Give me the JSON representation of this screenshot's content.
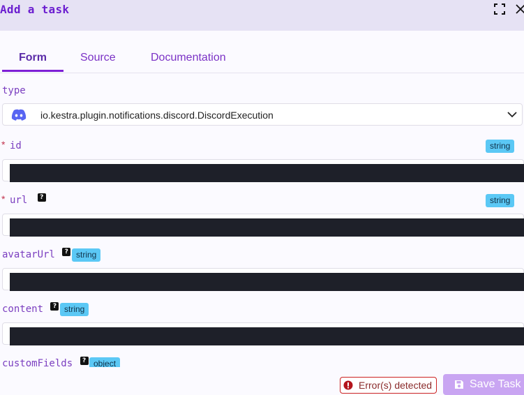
{
  "header": {
    "title": "Add a task",
    "fullscreen_icon": "fullscreen-icon",
    "close_icon": "close-icon"
  },
  "tabs": [
    {
      "label": "Form",
      "active": true
    },
    {
      "label": "Source",
      "active": false
    },
    {
      "label": "Documentation",
      "active": false
    }
  ],
  "type_field": {
    "label": "type",
    "value": "io.kestra.plugin.notifications.discord.DiscordExecution",
    "icon": "discord-icon"
  },
  "fields": [
    {
      "label": "id",
      "required": true,
      "help": false,
      "badge": "string",
      "value": ""
    },
    {
      "label": "url",
      "required": true,
      "help": true,
      "badge": "string",
      "value": ""
    },
    {
      "label": "avatarUrl",
      "required": false,
      "help": true,
      "badge": "string",
      "value": ""
    },
    {
      "label": "content",
      "required": false,
      "help": true,
      "badge": "string",
      "value": ""
    },
    {
      "label": "customFields",
      "required": false,
      "help": true,
      "badge": "object"
    }
  ],
  "required_mark": "*",
  "help_mark": "?",
  "footer": {
    "error_label": "Error(s) detected",
    "save_label": "Save Task"
  },
  "colors": {
    "accent": "#7e1fd6",
    "badge": "#5bc8f5",
    "error": "#cc2222",
    "save": "#c9a5f2",
    "input_fill": "#1e2029"
  }
}
